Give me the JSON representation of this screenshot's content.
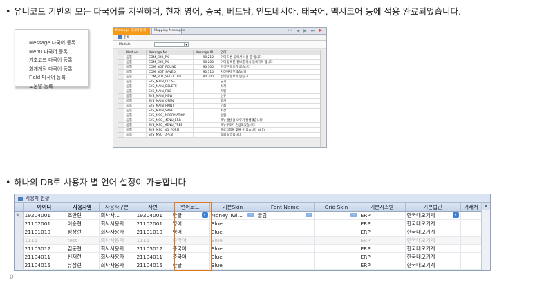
{
  "intro_line": "유니코드 기반의 모든 다국어를 지원하며, 현재 영어, 중국, 베트남, 인도네시아, 태국어, 멕시코어 등에 적용 완료되었습니다.",
  "second_line": "하나의 DB로 사용자 별 언어 설정이 가능합니다",
  "bullet": "•",
  "menu_items": [
    "Message 다국어 등록",
    "Menu 다국어 등록",
    "기초코드 다국어 등록",
    "회계계정 다국어 등록",
    "Field 다국어 등록",
    "도움말 등록"
  ],
  "msg_window": {
    "tabs": [
      "Message 다국어 등록",
      "Mapping-Messages"
    ],
    "window_controls": "⏮ ◀ ▶ ⏭",
    "close": "✖",
    "toolbar_label": "검색",
    "filter_label": "Module",
    "select_arrow": "▾",
    "columns": [
      "",
      "Module",
      "Message No",
      "Message ID",
      "언어1"
    ],
    "rows": [
      [
        "",
        "공통",
        "COM_ERR_PK",
        "90.210",
        "이미 다른 곳에서 사용 중 입니다"
      ],
      [
        "",
        "공통",
        "COM_ERR_PK",
        "90.200",
        "이미 등록된 정보를 다시 등록하려 합니다"
      ],
      [
        "",
        "공통",
        "COM_NOT_FOUND",
        "90.100",
        "검색된 정보가 없습니다"
      ],
      [
        "",
        "공통",
        "COM_NOT_SAVED",
        "90.110",
        "저장하지 못했습니다"
      ],
      [
        "",
        "공통",
        "COM_NOT_SELECTED",
        "90.300",
        "선택된 정보가 없습니다"
      ],
      [
        "",
        "공통",
        "SYS_MAIN_CLOSE",
        "",
        "닫기"
      ],
      [
        "",
        "공통",
        "SYS_MAIN_DELETE",
        "",
        "삭제"
      ],
      [
        "",
        "공통",
        "SYS_MAIN_FILE",
        "",
        "파일"
      ],
      [
        "",
        "공통",
        "SYS_MAIN_NEW",
        "",
        "신규"
      ],
      [
        "",
        "공통",
        "SYS_MAIN_OPEN",
        "",
        "열기"
      ],
      [
        "",
        "공통",
        "SYS_MAIN_PRINT",
        "",
        "인쇄"
      ],
      [
        "",
        "공통",
        "SYS_MAIN_SAVE",
        "",
        "저장"
      ],
      [
        "",
        "공통",
        "SYS_MSG_INFORMATION",
        "",
        "알림"
      ],
      [
        "",
        "공통",
        "SYS_MSG_MENU_ERR",
        "",
        "메뉴생성 중 오류가 발생했습니다"
      ],
      [
        "",
        "공통",
        "SYS_MSG_MENU_TREE",
        "",
        "메뉴구조가 손상되었습니다"
      ],
      [
        "",
        "공통",
        "SYS_MSG_NO_FORM",
        "",
        "프로그램을 찾을 수 없습니다 (#1)"
      ],
      [
        "",
        "공통",
        "SYS_MSG_OPEN",
        "",
        "조회 되었습니다"
      ]
    ]
  },
  "user_window": {
    "title": "사용자 현황",
    "columns": [
      "",
      "아이디",
      "사용자명",
      "사용자구분",
      "사번",
      "언어코드",
      "기본Skin",
      "Font Name",
      "Grid Skin",
      "기본시스템",
      "기본법인",
      "거래처"
    ],
    "scroll_up": "▲",
    "dd_arrow": "▾",
    "ellipsis": "···",
    "row_marker": "✎",
    "rows": [
      {
        "marker": "✎",
        "cells": [
          "19204001",
          "조만현",
          "회사사...",
          "19204001",
          "한글",
          "Money Twi...",
          "굴림",
          "",
          "ERP",
          "한국대모기계",
          ""
        ],
        "dim": false
      },
      {
        "marker": "",
        "cells": [
          "21102001",
          "이승현",
          "회사사용자",
          "21102001",
          "영어",
          "Blue",
          "",
          "",
          "ERP",
          "한국대모기계",
          ""
        ],
        "dim": false
      },
      {
        "marker": "",
        "cells": [
          "21101010",
          "정상현",
          "회사사용자",
          "21101010",
          "영어",
          "Blue",
          "",
          "",
          "ERP",
          "한국대모기계",
          ""
        ],
        "dim": false
      },
      {
        "marker": "",
        "cells": [
          "1111",
          "test",
          "회사사용자",
          "1111",
          "중국어",
          "Blue",
          "",
          "",
          "ERP",
          "한국대모기계",
          ""
        ],
        "dim": true
      },
      {
        "marker": "",
        "cells": [
          "21103012",
          "김동현",
          "회사사용자",
          "21103012",
          "중국어",
          "Blue",
          "",
          "",
          "ERP",
          "한국대모기계",
          ""
        ],
        "dim": false
      },
      {
        "marker": "",
        "cells": [
          "21104011",
          "신재현",
          "회사사용자",
          "21104011",
          "중국어",
          "Blue",
          "",
          "",
          "ERP",
          "한국대모기계",
          ""
        ],
        "dim": false
      },
      {
        "marker": "",
        "cells": [
          "21104015",
          "유정현",
          "회사사용자",
          "21104015",
          "한글",
          "Blue",
          "",
          "",
          "ERP",
          "한국대모기계",
          ""
        ],
        "dim": false
      }
    ]
  },
  "bottom_mark": "0",
  "colors": {
    "accent_orange": "#e07820",
    "header_blue": "#c7d5ea",
    "button_blue": "#3e80d6"
  }
}
